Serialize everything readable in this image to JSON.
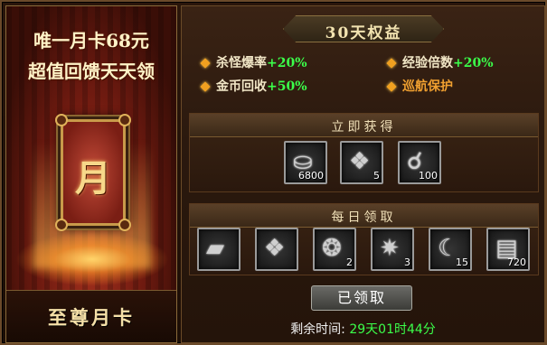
{
  "promo": {
    "line1": "唯一月卡68元",
    "line2": "超值回馈天天领",
    "card_char": "月",
    "card_name": "至尊月卡"
  },
  "header": {
    "title": "30天权益"
  },
  "benefits": [
    {
      "label": "杀怪爆率",
      "value": "+20%"
    },
    {
      "label": "经验倍数",
      "value": "+20%"
    },
    {
      "label": "金币回收",
      "value": "+50%"
    },
    {
      "label": "巡航保护",
      "value": ""
    }
  ],
  "instant": {
    "title": "立即获得",
    "items": [
      {
        "icon": "silver-ingot-icon",
        "count": "6800"
      },
      {
        "icon": "gem-charm-icon",
        "count": "5"
      },
      {
        "icon": "bead-chain-icon",
        "count": "100"
      }
    ]
  },
  "daily": {
    "title": "每日领取",
    "items": [
      {
        "icon": "silver-bar-icon",
        "count": ""
      },
      {
        "icon": "gem-charm-icon",
        "count": ""
      },
      {
        "icon": "pouch-icon",
        "count": "2"
      },
      {
        "icon": "spiked-orb-icon",
        "count": "3"
      },
      {
        "icon": "claw-icon",
        "count": "15"
      },
      {
        "icon": "scroll-icon",
        "count": "720"
      }
    ]
  },
  "claim_button": "已领取",
  "remaining": {
    "label": "剩余时间:",
    "value": "29天01时44分"
  },
  "colors": {
    "accent_green": "#3bff4a",
    "accent_orange": "#f0a030"
  }
}
